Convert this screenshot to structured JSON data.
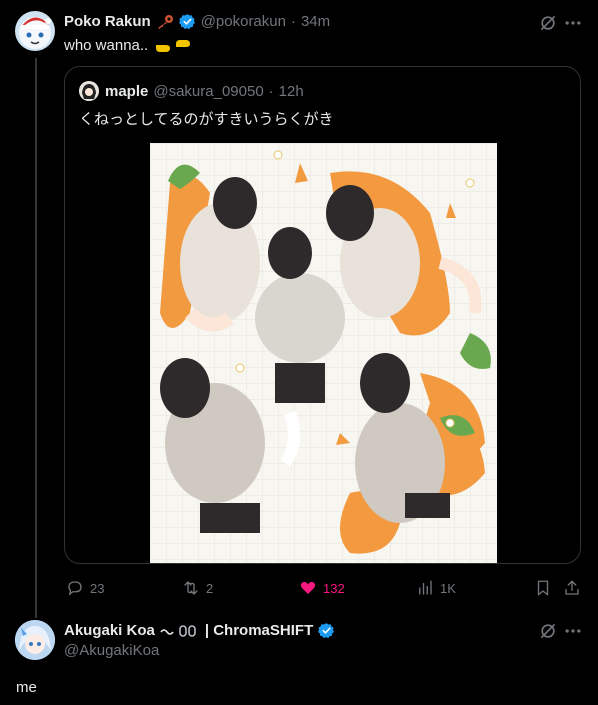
{
  "main_post": {
    "display_name": "Poko Rakun",
    "handle": "@pokorakun",
    "time": "34m",
    "text": "who wanna.."
  },
  "quoted_post": {
    "display_name": "maple",
    "handle": "@sakura_09050",
    "time": "12h",
    "text": "くねっとしてるのがすきいうらくがき"
  },
  "actions": {
    "replies": "23",
    "reposts": "2",
    "likes": "132",
    "views": "1K"
  },
  "reply_post": {
    "display_name": "Akugaki Koa",
    "name_suffix": "| ChromaSHIFT",
    "handle": "@AkugakiKoa",
    "text": "me"
  },
  "colors": {
    "background": "#000000",
    "text": "#e7e9ea",
    "muted": "#71767b",
    "like_active": "#f91880",
    "verified": "#1d9bf0",
    "border": "#2f3336"
  }
}
